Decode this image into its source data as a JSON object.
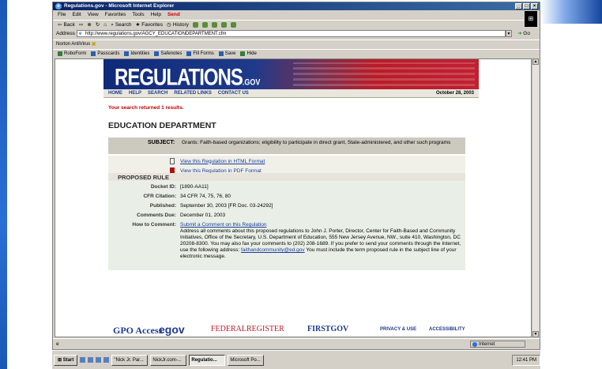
{
  "window": {
    "title": "Regulations.gov - Microsoft Internet Explorer",
    "min": "_",
    "max": "□",
    "close": "×"
  },
  "menu": [
    "File",
    "Edit",
    "View",
    "Favorites",
    "Tools",
    "Help"
  ],
  "menu_send": "Send",
  "toolbar": [
    "Back",
    "Search",
    "Favorites",
    "History"
  ],
  "address": {
    "label": "Address",
    "url": "http://www.regulations.gov/AGCY_EDUCATIONDEPARTMENT.cfm",
    "go": "Go"
  },
  "norton": "Norton AntiVirus",
  "roboform": [
    "RoboForm",
    "Passcards",
    "Identities",
    "Safenotes",
    "Fill Forms",
    "Save",
    "Hide"
  ],
  "site": {
    "logo_main": "REGULATIONS",
    "logo_suffix": ".GOV",
    "nav": [
      "HOME",
      "HELP",
      "SEARCH",
      "RELATED LINKS",
      "CONTACT US"
    ],
    "date": "October 28, 2003",
    "results_text": "Your search returned 1 results.",
    "agency_title": "EDUCATION DEPARTMENT",
    "subject_label": "SUBJECT:",
    "subject_value": "Grants: Faith-based organizations; eligibility to participate in direct grant, State-administered, and other such programs",
    "link_html": "View this Regulation in HTML Format",
    "link_pdf": "View this Regulation in PDF Format",
    "proposed_heading": "PROPOSED RULE",
    "details": {
      "docket_label": "Docket ID:",
      "docket_value": "[1890-AA11]",
      "cfr_label": "CFR Citation:",
      "cfr_value": "34 CFR 74, 75, 76, 80",
      "published_label": "Published:",
      "published_value": "September 30, 2003 [FR Doc. 03-24292]",
      "due_label": "Comments Due:",
      "due_value": "December 01, 2003",
      "how_label": "How to Comment:",
      "how_link": "Submit a Comment on this Regulation",
      "how_text": "Address all comments about this proposed regulations to John J. Porter, Director, Center for Faith-Based and Community Initiatives, Office of the Secretary, U.S. Department of Education, 555 New Jersey Avenue, NW., suite 410, Washington, DC 20208-8300. You may also fax your comments to (202) 208-1689. If you prefer to send your comments through the Internet, use the following address:",
      "how_email": "faithandcommunity@ed.gov",
      "how_tail": "You must include the term proposed rule in the subject line of your electronic message."
    },
    "footer": {
      "gpo": "GPO Access",
      "egov": "egov",
      "fedreg": "FEDERALREGISTER",
      "firstgov": "FIRSTGOV",
      "privacy": "PRIVACY & USE",
      "accessibility": "ACCESSIBILITY"
    }
  },
  "status": {
    "zone": "Internet"
  },
  "taskbar": {
    "start": "Start",
    "tasks": [
      "\"Nick Jr. Par...",
      "NickJr.com-...",
      "Regulatio...",
      "Microsoft Po..."
    ],
    "clock": "12:41 PM"
  },
  "colors": {
    "banner_blue": "#1e3a8a",
    "banner_red": "#c02030",
    "results_red": "#c00000",
    "link_blue": "#1a3e9a"
  }
}
